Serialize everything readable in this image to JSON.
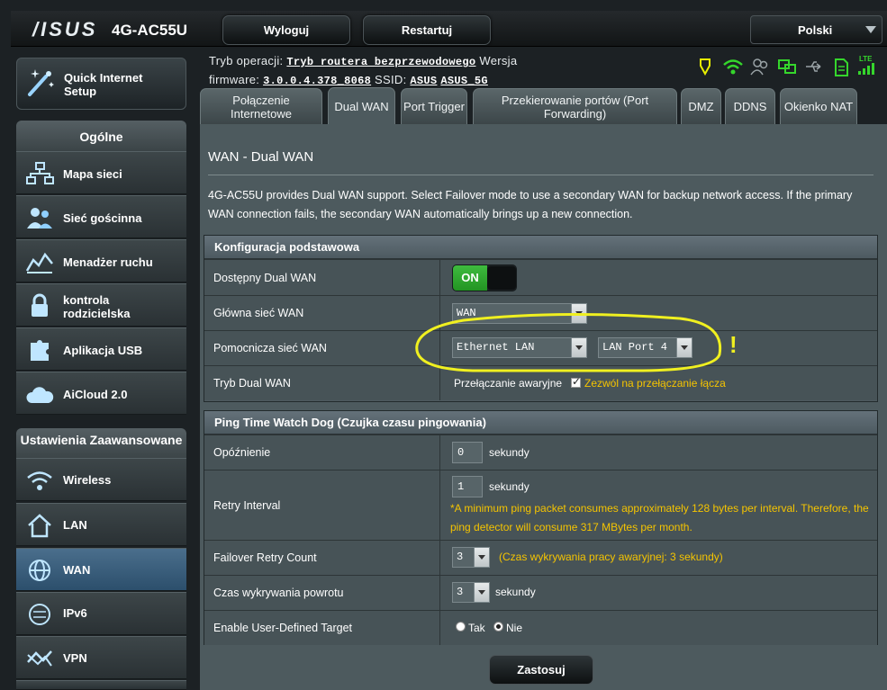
{
  "header": {
    "logo": "/ISUS",
    "model": "4G-AC55U",
    "logout": "Wyloguj",
    "restart": "Restartuj",
    "language": "Polski"
  },
  "status": {
    "mode_label": "Tryb operacji:",
    "mode_value": "Tryb routera bezprzewodowego",
    "version_label": "Wersja",
    "firmware_label": "firmware:",
    "firmware_value": "3.0.0.4.378_8068",
    "ssid_label": "SSID:",
    "ssid_1": "ASUS",
    "ssid_2": "ASUS_5G",
    "icons": [
      "sim-icon",
      "wifi-icon",
      "users-icon",
      "network-icon",
      "usb-icon",
      "sd-card-icon",
      "lte-signal-icon"
    ],
    "lte_text": "LTE"
  },
  "sidebar": {
    "quick_setup": "Quick Internet Setup",
    "general_title": "Ogólne",
    "general_items": [
      {
        "label": "Mapa sieci",
        "icon": "network-map-icon"
      },
      {
        "label": "Sieć gościnna",
        "icon": "guest-network-icon"
      },
      {
        "label": "Menadżer ruchu",
        "icon": "traffic-manager-icon"
      },
      {
        "label": "kontrola rodzicielska",
        "icon": "lock-icon"
      },
      {
        "label": "Aplikacja USB",
        "icon": "puzzle-icon"
      },
      {
        "label": "AiCloud 2.0",
        "icon": "cloud-icon"
      }
    ],
    "advanced_title": "Ustawienia Zaawansowane",
    "advanced_items": [
      {
        "label": "Wireless",
        "icon": "wireless-icon"
      },
      {
        "label": "LAN",
        "icon": "home-icon"
      },
      {
        "label": "WAN",
        "icon": "globe-icon"
      },
      {
        "label": "IPv6",
        "icon": "ipv6-icon"
      },
      {
        "label": "VPN",
        "icon": "vpn-icon"
      }
    ]
  },
  "tabs": [
    {
      "label": "Połączenie Internetowe"
    },
    {
      "label": "Dual WAN"
    },
    {
      "label": "Port Trigger"
    },
    {
      "label": "Przekierowanie portów (Port Forwarding)"
    },
    {
      "label": "DMZ"
    },
    {
      "label": "DDNS"
    },
    {
      "label": "Okienko NAT"
    }
  ],
  "page": {
    "title": "WAN - Dual WAN",
    "description": "4G-AC55U provides Dual WAN support. Select Failover mode to use a secondary WAN for backup network access. If the primary WAN connection fails, the secondary WAN automatically brings up a new connection."
  },
  "basic": {
    "header": "Konfiguracja podstawowa",
    "dual_wan_label": "Dostępny Dual WAN",
    "dual_wan_state": "ON",
    "primary_label": "Główna sieć WAN",
    "primary_value": "WAN",
    "secondary_label": "Pomocnicza sieć WAN",
    "secondary_value": "Ethernet LAN",
    "secondary_port": "LAN Port 4",
    "mode_label": "Tryb Dual WAN",
    "mode_value": "Przełączanie awaryjne",
    "allow_failback": "Zezwól na przełączanie łącza",
    "annotation_mark": "!"
  },
  "ping": {
    "header": "Ping Time Watch Dog (Czujka czasu pingowania)",
    "delay_label": "Opóźnienie",
    "delay_value": "0",
    "seconds": "sekundy",
    "retry_label": "Retry Interval",
    "retry_value": "1",
    "retry_note": "*A minimum ping packet consumes approximately 128 bytes per interval. Therefore, the ping detector will consume 317 MBytes per month.",
    "failover_label": "Failover Retry Count",
    "failover_value": "3",
    "failover_note": "(Czas wykrywania pracy awaryjnej: 3  sekundy)",
    "recovery_label": "Czas wykrywania powrotu",
    "recovery_value": "3",
    "target_label": "Enable User-Defined Target",
    "target_yes": "Tak",
    "target_no": "Nie"
  },
  "apply": "Zastosuj",
  "colors": {
    "accent_yellow": "#f5c400",
    "toggle_green": "#2aa52a",
    "annotation": "#f0f020",
    "status_green": "#35d62c"
  }
}
